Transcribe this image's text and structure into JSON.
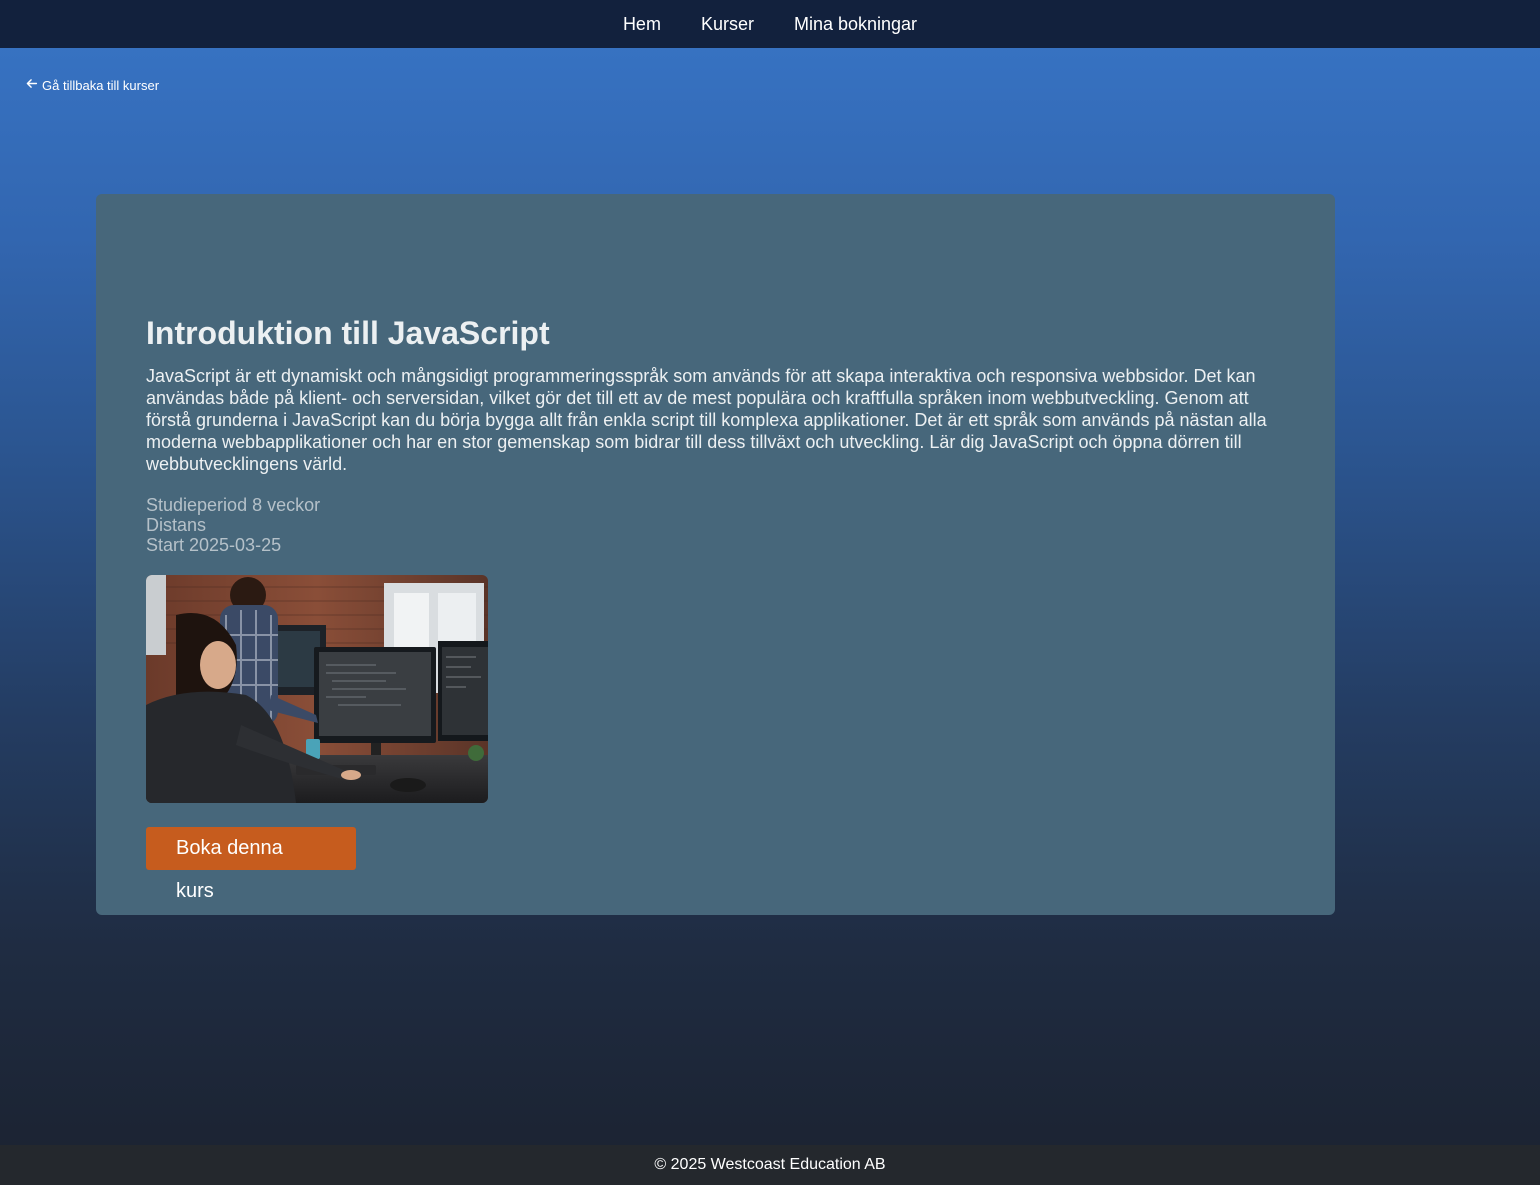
{
  "nav": {
    "items": [
      {
        "label": "Hem"
      },
      {
        "label": "Kurser"
      },
      {
        "label": "Mina bokningar"
      }
    ]
  },
  "back_link": {
    "label": "Gå tillbaka till kurser",
    "icon": "arrow-left-icon"
  },
  "course": {
    "title": "Introduktion till JavaScript",
    "description": "JavaScript är ett dynamiskt och mångsidigt programmeringsspråk som används för att skapa interaktiva och responsiva webbsidor. Det kan användas både på klient- och serversidan, vilket gör det till ett av de mest populära och kraftfulla språken inom webbutveckling. Genom att förstå grunderna i JavaScript kan du börja bygga allt från enkla script till komplexa applikationer. Det är ett språk som används på nästan alla moderna webbapplikationer och har en stor gemenskap som bidrar till dess tillväxt och utveckling. Lär dig JavaScript och öppna dörren till webbutvecklingens värld.",
    "study_period": "Studieperiod 8 veckor",
    "mode": "Distans",
    "start": "Start 2025-03-25",
    "book_label": "Boka denna kurs"
  },
  "footer": {
    "text": "© 2025 Westcoast Education AB"
  },
  "colors": {
    "nav_bg": "#12213d",
    "card_bg": "#47677b",
    "button_bg": "#c65c1e",
    "footer_bg": "#24282d"
  }
}
